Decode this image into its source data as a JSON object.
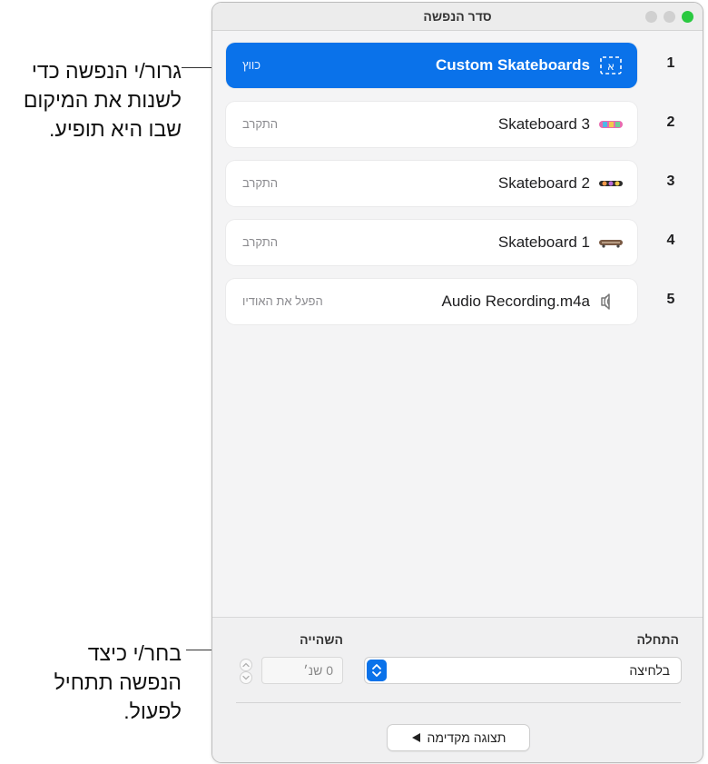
{
  "callouts": {
    "drag": [
      "גרור/י הנפשה כדי",
      "לשנות את המיקום",
      "שבו היא תופיע."
    ],
    "choose": [
      "בחר/י כיצד",
      "הנפשה תתחיל",
      "לפעול."
    ]
  },
  "window": {
    "title": "סדר הנפשה"
  },
  "rows": [
    {
      "num": "1",
      "name": "Custom Skateboards",
      "action": "כווץ",
      "icon": "text-frame-icon",
      "selected": true
    },
    {
      "num": "2",
      "name": "Skateboard 3",
      "action": "התקרב",
      "icon": "skateboard-image-icon",
      "selected": false
    },
    {
      "num": "3",
      "name": "Skateboard 2",
      "action": "התקרב",
      "icon": "skateboard-image-icon",
      "selected": false
    },
    {
      "num": "4",
      "name": "Skateboard 1",
      "action": "התקרב",
      "icon": "skateboard-image-icon",
      "selected": false
    },
    {
      "num": "5",
      "name": "Audio Recording.m4a",
      "action": "הפעל את האודיו",
      "icon": "speaker-icon",
      "selected": false
    }
  ],
  "bottom": {
    "start_label": "התחלה",
    "start_value": "בלחיצה",
    "delay_label": "השהייה",
    "delay_value": "0 שנ׳",
    "preview_label": "תצוגה מקדימה"
  },
  "colors": {
    "accent": "#0a72ea",
    "close_light": "#2ac940"
  }
}
